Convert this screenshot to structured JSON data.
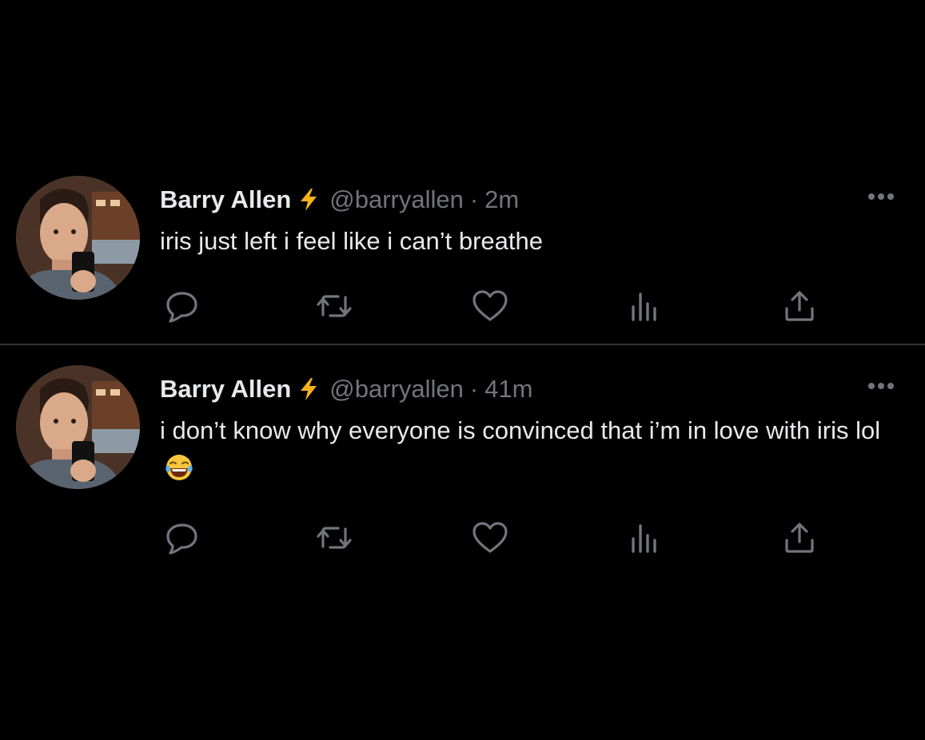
{
  "theme": {
    "background": "#000000",
    "text": "#e7e9ea",
    "muted": "#71767b",
    "verified_bolt": "#f5b21b"
  },
  "tweets": [
    {
      "author_name": "Barry Allen",
      "badge_icon": "lightning-bolt-icon",
      "handle": "@barryallen",
      "separator": "·",
      "time": "2m",
      "text": "iris just left i feel like i can’t breathe",
      "emoji": ""
    },
    {
      "author_name": "Barry Allen",
      "badge_icon": "lightning-bolt-icon",
      "handle": "@barryallen",
      "separator": "·",
      "time": "41m",
      "text": "i don’t know why everyone is convinced that i’m in love with iris lol",
      "emoji": "tears-of-joy-emoji"
    }
  ],
  "action_icons": [
    "reply-icon",
    "retweet-icon",
    "like-icon",
    "views-icon",
    "share-icon"
  ]
}
